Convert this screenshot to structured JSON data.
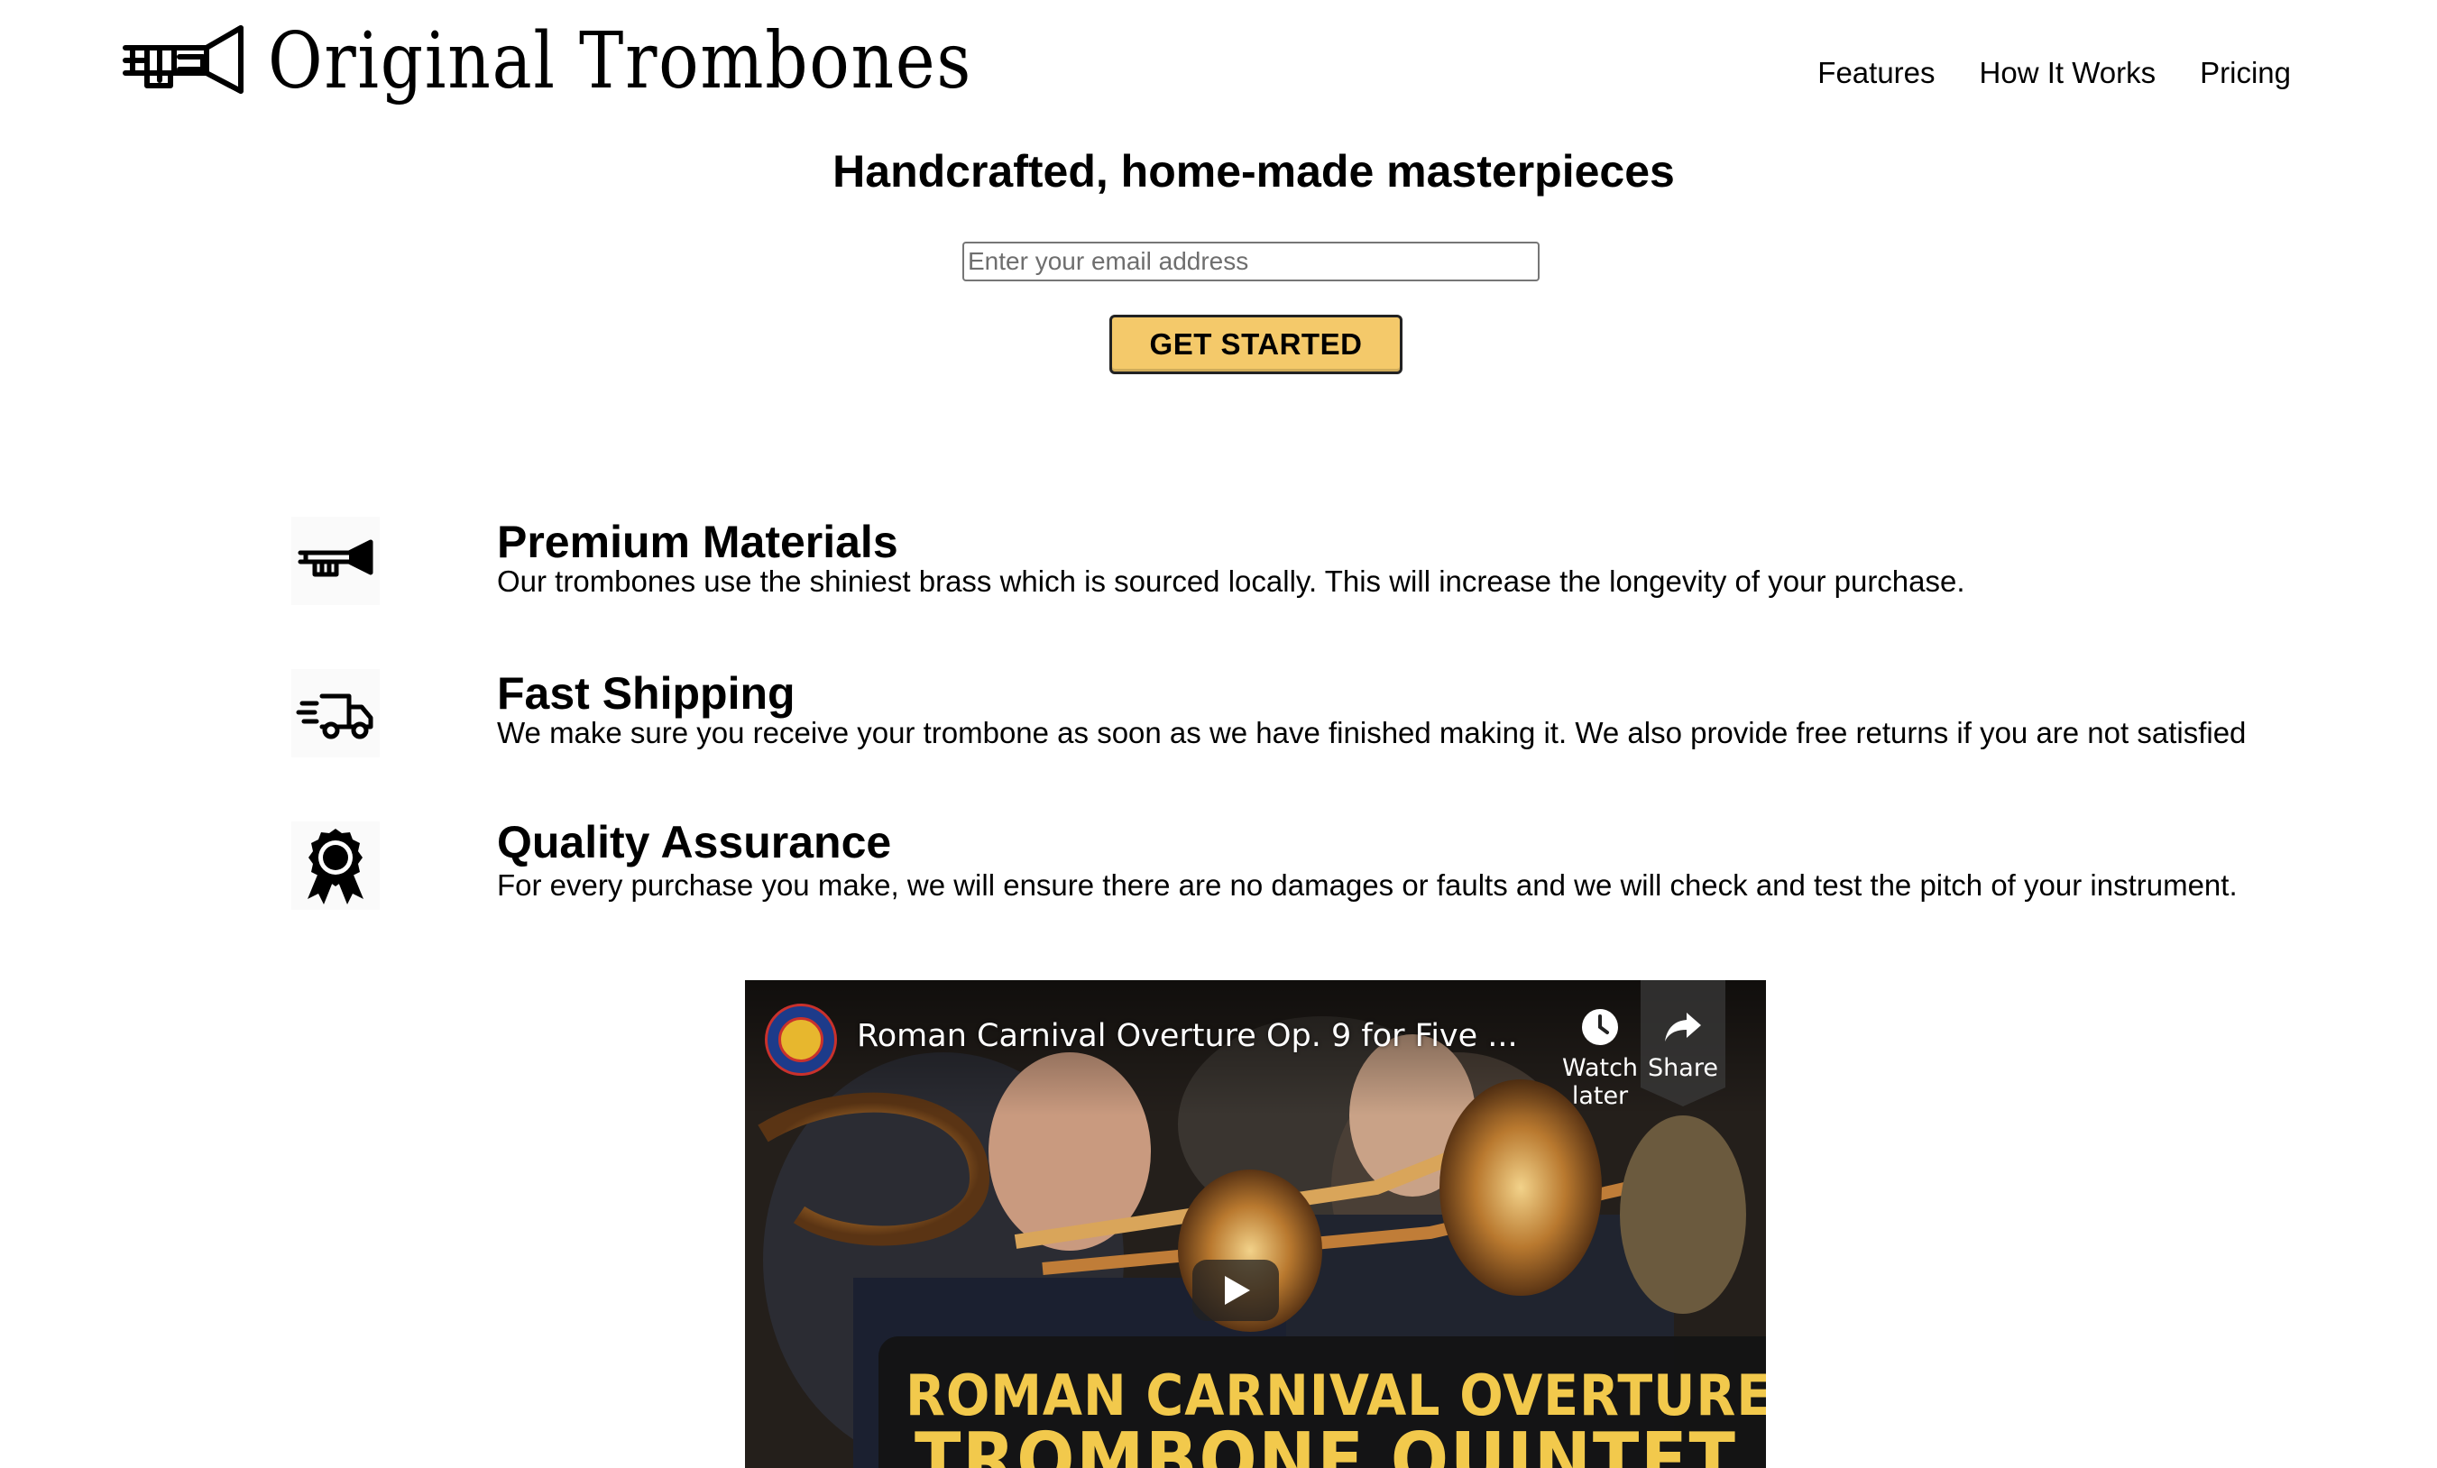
{
  "header": {
    "brand_name": "Original Trombones",
    "logo_icon": "trombone-logo-icon",
    "nav": [
      {
        "label": "Features"
      },
      {
        "label": "How It Works"
      },
      {
        "label": "Pricing"
      }
    ]
  },
  "hero": {
    "title": "Handcrafted, home-made masterpieces",
    "email_placeholder": "Enter your email address",
    "email_value": "",
    "cta_label": "GET STARTED",
    "cta_color": "#f4c96a"
  },
  "features": [
    {
      "icon": "trumpet-icon",
      "title": "Premium Materials",
      "text": "Our trombones use the shiniest brass which is sourced locally. This will increase the longevity of your purchase."
    },
    {
      "icon": "truck-icon",
      "title": "Fast Shipping",
      "text": "We make sure you receive your trombone as soon as we have finished making it. We also provide free returns if you are not satisfied"
    },
    {
      "icon": "award-ribbon-icon",
      "title": "Quality Assurance",
      "text": "For every purchase you make, we will ensure there are no damages or faults and we will check and test the pitch of your instrument."
    }
  ],
  "video": {
    "title": "Roman Carnival Overture Op. 9 for Five ...",
    "watch_later_label": "Watch later",
    "share_label": "Share",
    "thumbnail_line1": "ROMAN CARNIVAL OVERTURE",
    "thumbnail_line2": "TROMBONE QUINTET",
    "accent_color": "#f2c94c"
  }
}
